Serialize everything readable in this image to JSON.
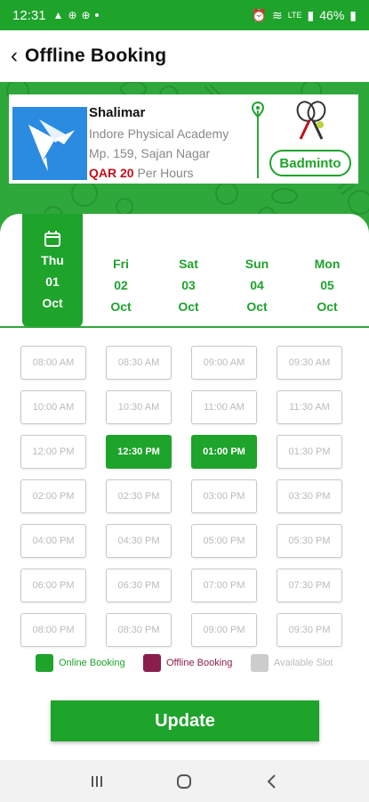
{
  "status": {
    "time": "12:31",
    "battery": "46%",
    "lte": "LTE"
  },
  "header": {
    "title": "Offline Booking"
  },
  "venue": {
    "name": "Shalimar",
    "academy": "Indore Physical Academy",
    "address": "Mp. 159, Sajan Nagar",
    "price_amount": "QAR 20",
    "price_unit": "Per Hours",
    "sport": "Badminto"
  },
  "dates": [
    {
      "day": "Thu",
      "num": "01",
      "month": "Oct",
      "selected": true
    },
    {
      "day": "Fri",
      "num": "02",
      "month": "Oct",
      "selected": false
    },
    {
      "day": "Sat",
      "num": "03",
      "month": "Oct",
      "selected": false
    },
    {
      "day": "Sun",
      "num": "04",
      "month": "Oct",
      "selected": false
    },
    {
      "day": "Mon",
      "num": "05",
      "month": "Oct",
      "selected": false
    }
  ],
  "slots": [
    {
      "time": "08:00 AM",
      "status": "available"
    },
    {
      "time": "08:30 AM",
      "status": "available"
    },
    {
      "time": "09:00 AM",
      "status": "available"
    },
    {
      "time": "09:30 AM",
      "status": "available"
    },
    {
      "time": "10:00 AM",
      "status": "available"
    },
    {
      "time": "10:30 AM",
      "status": "available"
    },
    {
      "time": "11:00 AM",
      "status": "available"
    },
    {
      "time": "11:30 AM",
      "status": "available"
    },
    {
      "time": "12:00 PM",
      "status": "available"
    },
    {
      "time": "12:30 PM",
      "status": "online"
    },
    {
      "time": "01:00 PM",
      "status": "online"
    },
    {
      "time": "01:30 PM",
      "status": "available"
    },
    {
      "time": "02:00 PM",
      "status": "available"
    },
    {
      "time": "02:30 PM",
      "status": "available"
    },
    {
      "time": "03:00 PM",
      "status": "available"
    },
    {
      "time": "03:30 PM",
      "status": "available"
    },
    {
      "time": "04:00 PM",
      "status": "available"
    },
    {
      "time": "04:30 PM",
      "status": "available"
    },
    {
      "time": "05:00 PM",
      "status": "available"
    },
    {
      "time": "05:30 PM",
      "status": "available"
    },
    {
      "time": "06:00 PM",
      "status": "available"
    },
    {
      "time": "06:30 PM",
      "status": "available"
    },
    {
      "time": "07:00 PM",
      "status": "available"
    },
    {
      "time": "07:30 PM",
      "status": "available"
    },
    {
      "time": "08:00 PM",
      "status": "available"
    },
    {
      "time": "08:30 PM",
      "status": "available"
    },
    {
      "time": "09:00 PM",
      "status": "available"
    },
    {
      "time": "09:30 PM",
      "status": "available"
    }
  ],
  "legend": {
    "online": "Online Booking",
    "offline": "Offline Booking",
    "available": "Available Slot"
  },
  "colors": {
    "online": "#1ea32b",
    "offline": "#8b1d4a",
    "available": "#cccccc",
    "brand": "#1ea32b"
  },
  "actions": {
    "update": "Update"
  }
}
